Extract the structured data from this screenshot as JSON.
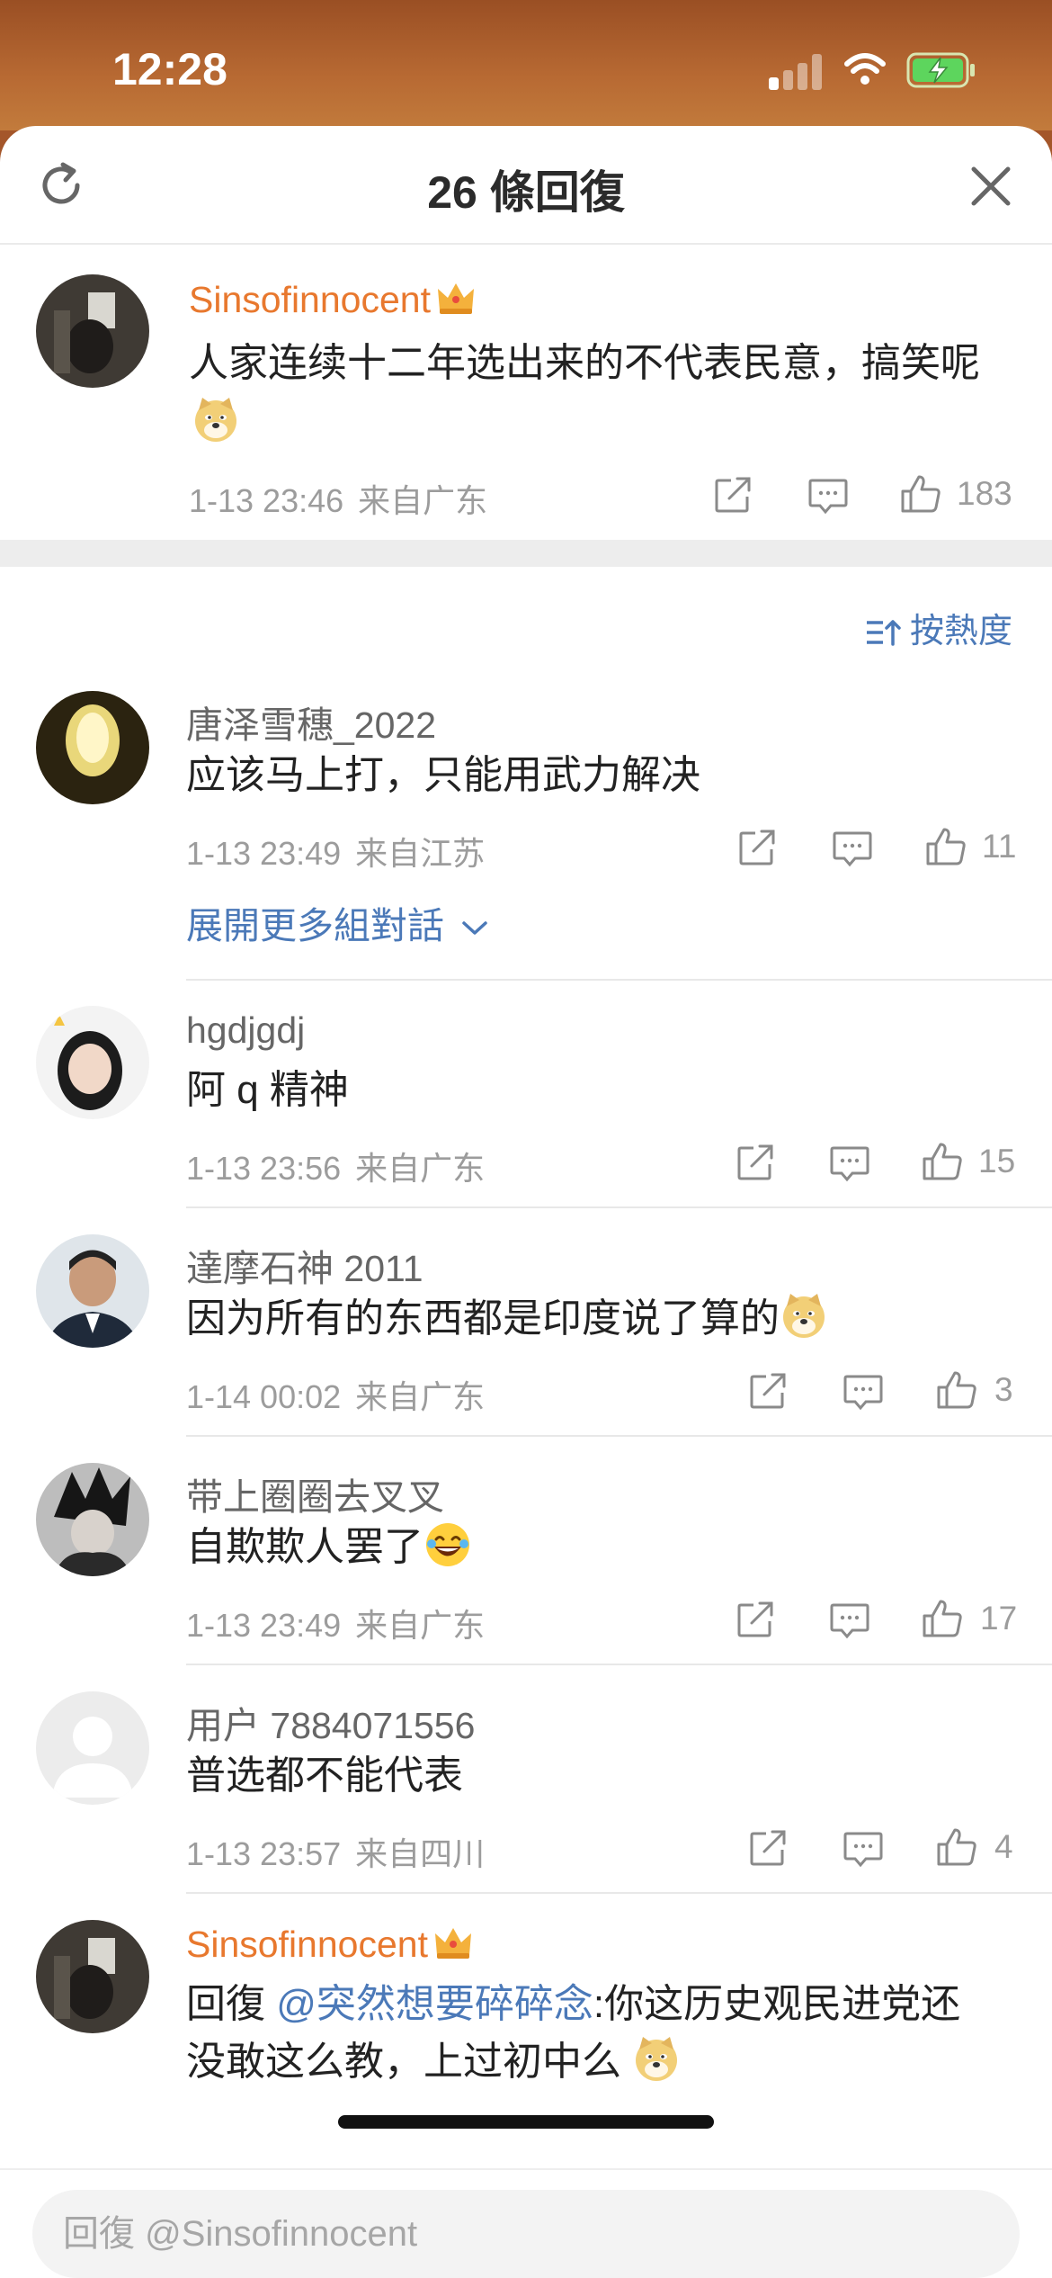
{
  "status_bar": {
    "time": "12:28"
  },
  "header": {
    "title": "26 條回復"
  },
  "main_comment": {
    "username": "Sinsofinnocent",
    "text": "人家连续十二年选出来的不代表民意，搞笑呢",
    "date": "1-13 23:46",
    "location": "来自广东",
    "likes": "183"
  },
  "sort": {
    "label": "按熱度"
  },
  "replies": [
    {
      "username": "唐泽雪穗_2022",
      "text": "应该马上打，只能用武力解决",
      "date": "1-13 23:49",
      "location": "来自江苏",
      "likes": "11"
    },
    {
      "username": "hgdjgdj",
      "text": "阿 q 精神",
      "date": "1-13 23:56",
      "location": "来自广东",
      "likes": "15"
    },
    {
      "username": "達摩石神 2011",
      "text": "因为所有的东西都是印度说了算的",
      "date": "1-14 00:02",
      "location": "来自广东",
      "likes": "3"
    },
    {
      "username": "带上圈圈去叉叉",
      "text": "自欺欺人罢了",
      "date": "1-13 23:49",
      "location": "来自广东",
      "likes": "17"
    },
    {
      "username": "用户 7884071556",
      "text": "普选都不能代表",
      "date": "1-13 23:57",
      "location": "来自四川",
      "likes": "4"
    },
    {
      "username": "Sinsofinnocent",
      "reply_prefix": "回復",
      "mention": "@突然想要碎碎念",
      "text": ":你这历史观民进党还",
      "text_line2": "没敢这么教，上过初中么"
    }
  ],
  "expand_link": "展開更多組對話",
  "reply_input": {
    "placeholder": "回復 @Sinsofinnocent"
  },
  "colors": {
    "accent_blue": "#4b79b8",
    "vip_orange": "#e8782e",
    "status_bg": "#a4562a",
    "battery_green": "#5dd55d"
  },
  "icons": [
    "refresh-icon",
    "close-icon",
    "crown-icon",
    "share-icon",
    "comment-icon",
    "like-icon",
    "sort-icon",
    "chevron-down-icon",
    "doge-emoji",
    "laugh-emoji",
    "wifi-icon",
    "battery-icon",
    "signal-icon"
  ]
}
